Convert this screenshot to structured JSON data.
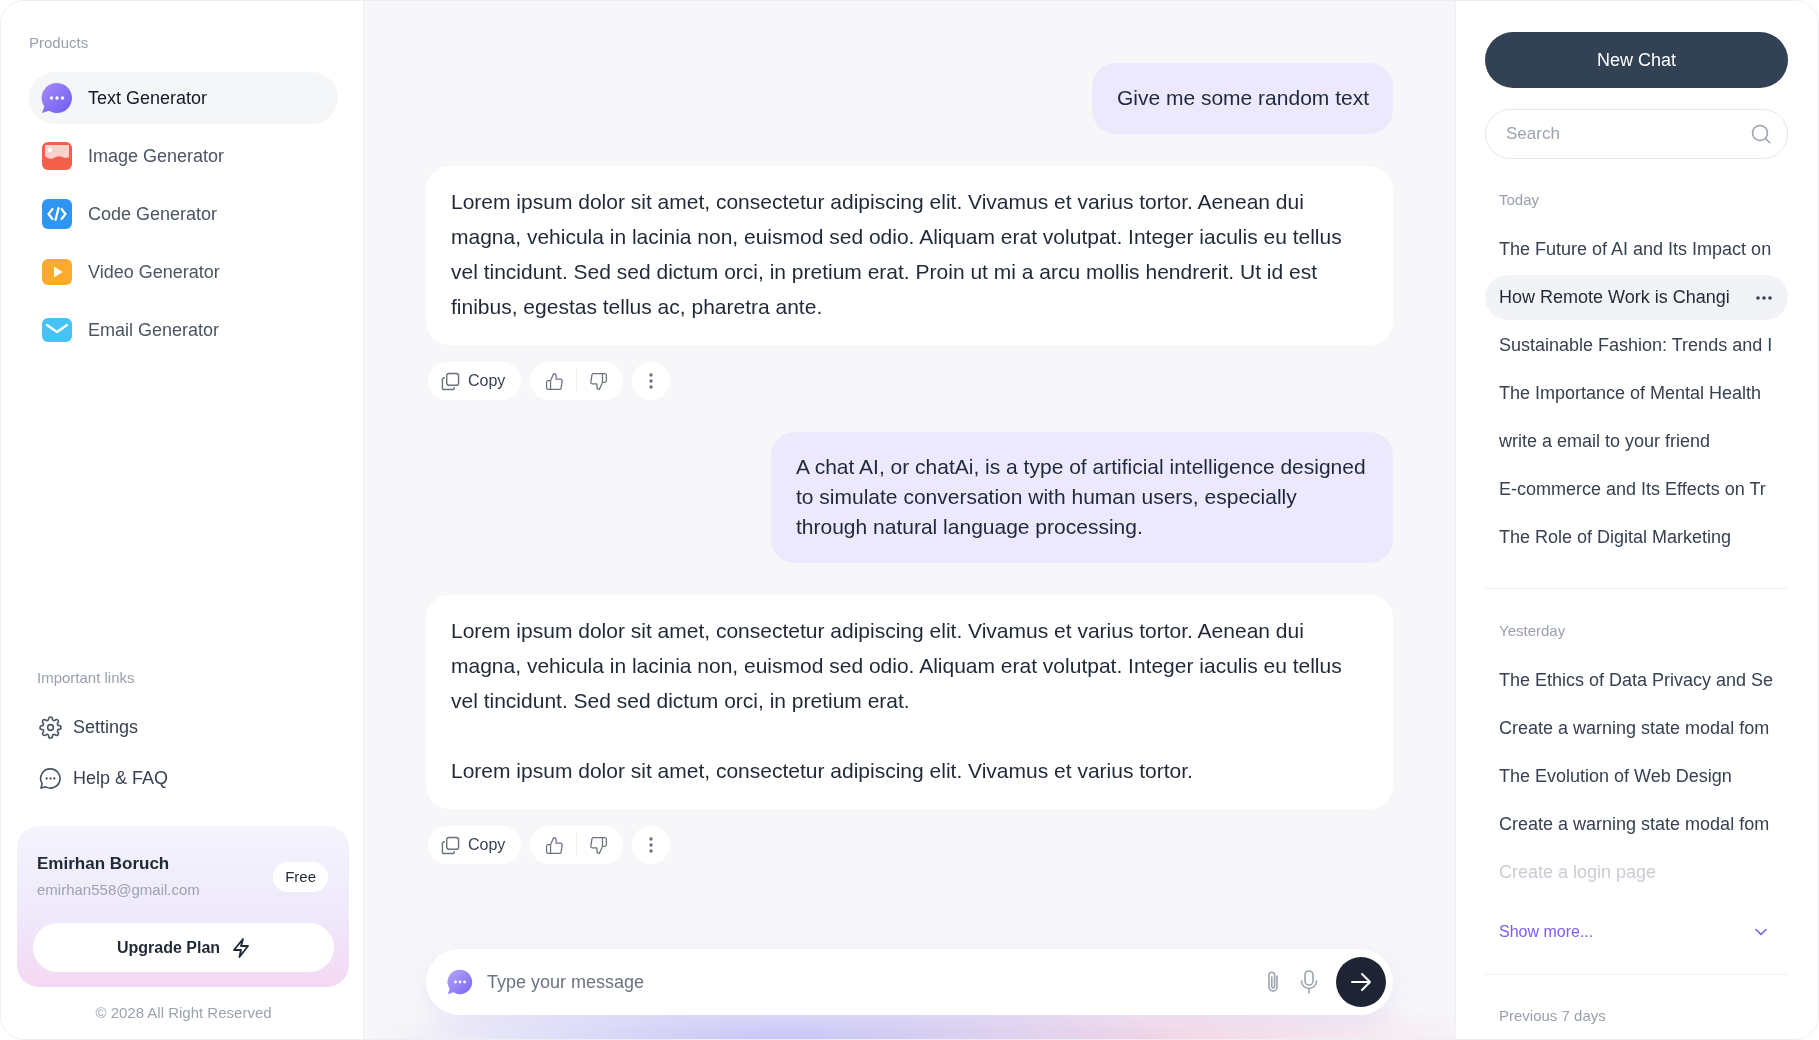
{
  "sidebar": {
    "products_title": "Products",
    "products": [
      {
        "label": "Text Generator",
        "selected": true
      },
      {
        "label": "Image Generator",
        "selected": false
      },
      {
        "label": "Code Generator",
        "selected": false
      },
      {
        "label": "Video Generator",
        "selected": false
      },
      {
        "label": "Email Generator",
        "selected": false
      }
    ],
    "links_title": "Important links",
    "links": [
      {
        "label": "Settings"
      },
      {
        "label": "Help & FAQ"
      }
    ],
    "account": {
      "name": "Emirhan Boruch",
      "email": "emirhan558@gmail.com",
      "plan": "Free",
      "upgrade_button": "Upgrade Plan"
    },
    "copyright": "© 2028 All Right Reserved"
  },
  "chat": {
    "messages": [
      {
        "kind": "user",
        "text": "Give me some random text"
      },
      {
        "kind": "assistant",
        "paragraphs": [
          "Lorem ipsum dolor sit amet, consectetur adipiscing elit. Vivamus et varius tortor. Aenean dui magna, vehicula in lacinia non, euismod sed odio. Aliquam erat volutpat. Integer iaculis eu tellus vel tincidunt. Sed sed dictum orci, in pretium erat. Proin ut mi a arcu mollis hendrerit. Ut id est finibus, egestas tellus ac, pharetra ante."
        ],
        "copy_label": "Copy"
      },
      {
        "kind": "user",
        "text": "A chat AI, or chatAi, is a type of artificial intelligence designed to simulate conversation with human users, especially through natural language processing."
      },
      {
        "kind": "assistant",
        "paragraphs": [
          "Lorem ipsum dolor sit amet, consectetur adipiscing elit. Vivamus et varius tortor. Aenean dui magna, vehicula in lacinia non, euismod sed odio. Aliquam erat volutpat. Integer iaculis eu tellus vel tincidunt. Sed sed dictum orci, in pretium erat.",
          "Lorem ipsum dolor sit amet, consectetur adipiscing elit. Vivamus et varius tortor."
        ],
        "copy_label": "Copy"
      }
    ],
    "composer": {
      "placeholder": "Type your message"
    }
  },
  "history": {
    "new_chat_button": "New Chat",
    "search": {
      "placeholder": "Search"
    },
    "groups": [
      {
        "title": "Today",
        "items": [
          {
            "title": "The Future of AI and Its Impact on",
            "selected": false,
            "faded": false
          },
          {
            "title": "How Remote Work is Changi",
            "selected": true,
            "faded": false
          },
          {
            "title": "Sustainable Fashion: Trends and I",
            "selected": false,
            "faded": false
          },
          {
            "title": "The Importance of Mental Health",
            "selected": false,
            "faded": false
          },
          {
            "title": "write a email to your friend",
            "selected": false,
            "faded": false
          },
          {
            "title": "E-commerce and Its Effects on Tr",
            "selected": false,
            "faded": false
          },
          {
            "title": "The Role of Digital Marketing",
            "selected": false,
            "faded": false
          }
        ]
      },
      {
        "title": "Yesterday",
        "items": [
          {
            "title": "The Ethics of Data Privacy and Se",
            "selected": false,
            "faded": false
          },
          {
            "title": "Create a warning state modal fom",
            "selected": false,
            "faded": false
          },
          {
            "title": "The Evolution of Web Design",
            "selected": false,
            "faded": false
          },
          {
            "title": "Create a warning state modal fom",
            "selected": false,
            "faded": false
          },
          {
            "title": "Create a login page",
            "selected": false,
            "faded": true
          }
        ],
        "show_more": "Show more..."
      },
      {
        "title": "Previous 7 days"
      }
    ]
  }
}
